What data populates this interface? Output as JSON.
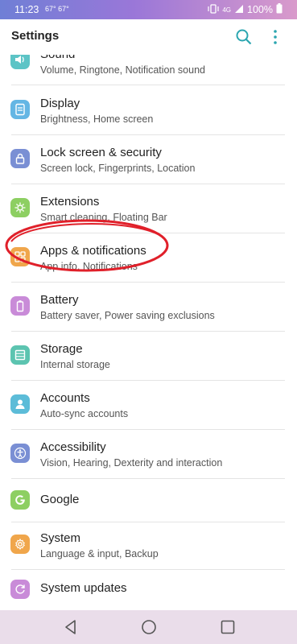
{
  "status_bar": {
    "time": "11:23",
    "temps": "67° 67°",
    "network": "4G",
    "battery": "100%"
  },
  "app_bar": {
    "title": "Settings",
    "search_icon": "search-icon",
    "more_icon": "more-vert-icon"
  },
  "items": [
    {
      "label": "Sound",
      "sub": "Volume, Ringtone, Notification sound",
      "icon": "volume-icon",
      "color": "#5cc4c6"
    },
    {
      "label": "Display",
      "sub": "Brightness, Home screen",
      "icon": "display-icon",
      "color": "#64b6e4"
    },
    {
      "label": "Lock screen & security",
      "sub": "Screen lock, Fingerprints, Location",
      "icon": "lock-icon",
      "color": "#7a8fd4"
    },
    {
      "label": "Extensions",
      "sub": "Smart cleaning, Floating Bar",
      "icon": "extensions-icon",
      "color": "#8dcf62"
    },
    {
      "label": "Apps & notifications",
      "sub": "App info, Notifications",
      "icon": "apps-grid-icon",
      "color": "#f0a64b"
    },
    {
      "label": "Battery",
      "sub": "Battery saver, Power saving exclusions",
      "icon": "battery-icon",
      "color": "#c98bd8"
    },
    {
      "label": "Storage",
      "sub": "Internal storage",
      "icon": "storage-icon",
      "color": "#5cc4b0"
    },
    {
      "label": "Accounts",
      "sub": "Auto-sync accounts",
      "icon": "account-icon",
      "color": "#5cbcd8"
    },
    {
      "label": "Accessibility",
      "sub": "Vision, Hearing, Dexterity and interaction",
      "icon": "accessibility-icon",
      "color": "#7a8fd4"
    },
    {
      "label": "Google",
      "sub": "",
      "icon": "google-icon",
      "color": "#8dcf62"
    },
    {
      "label": "System",
      "sub": "Language & input, Backup",
      "icon": "system-gear-icon",
      "color": "#f0a64b"
    },
    {
      "label": "System updates",
      "sub": "",
      "icon": "system-update-icon",
      "color": "#c98bd8"
    }
  ],
  "nav_bar": {
    "back_icon": "back-icon",
    "home_icon": "home-icon",
    "recents_icon": "recents-icon"
  },
  "highlight_color": "#e0202a"
}
